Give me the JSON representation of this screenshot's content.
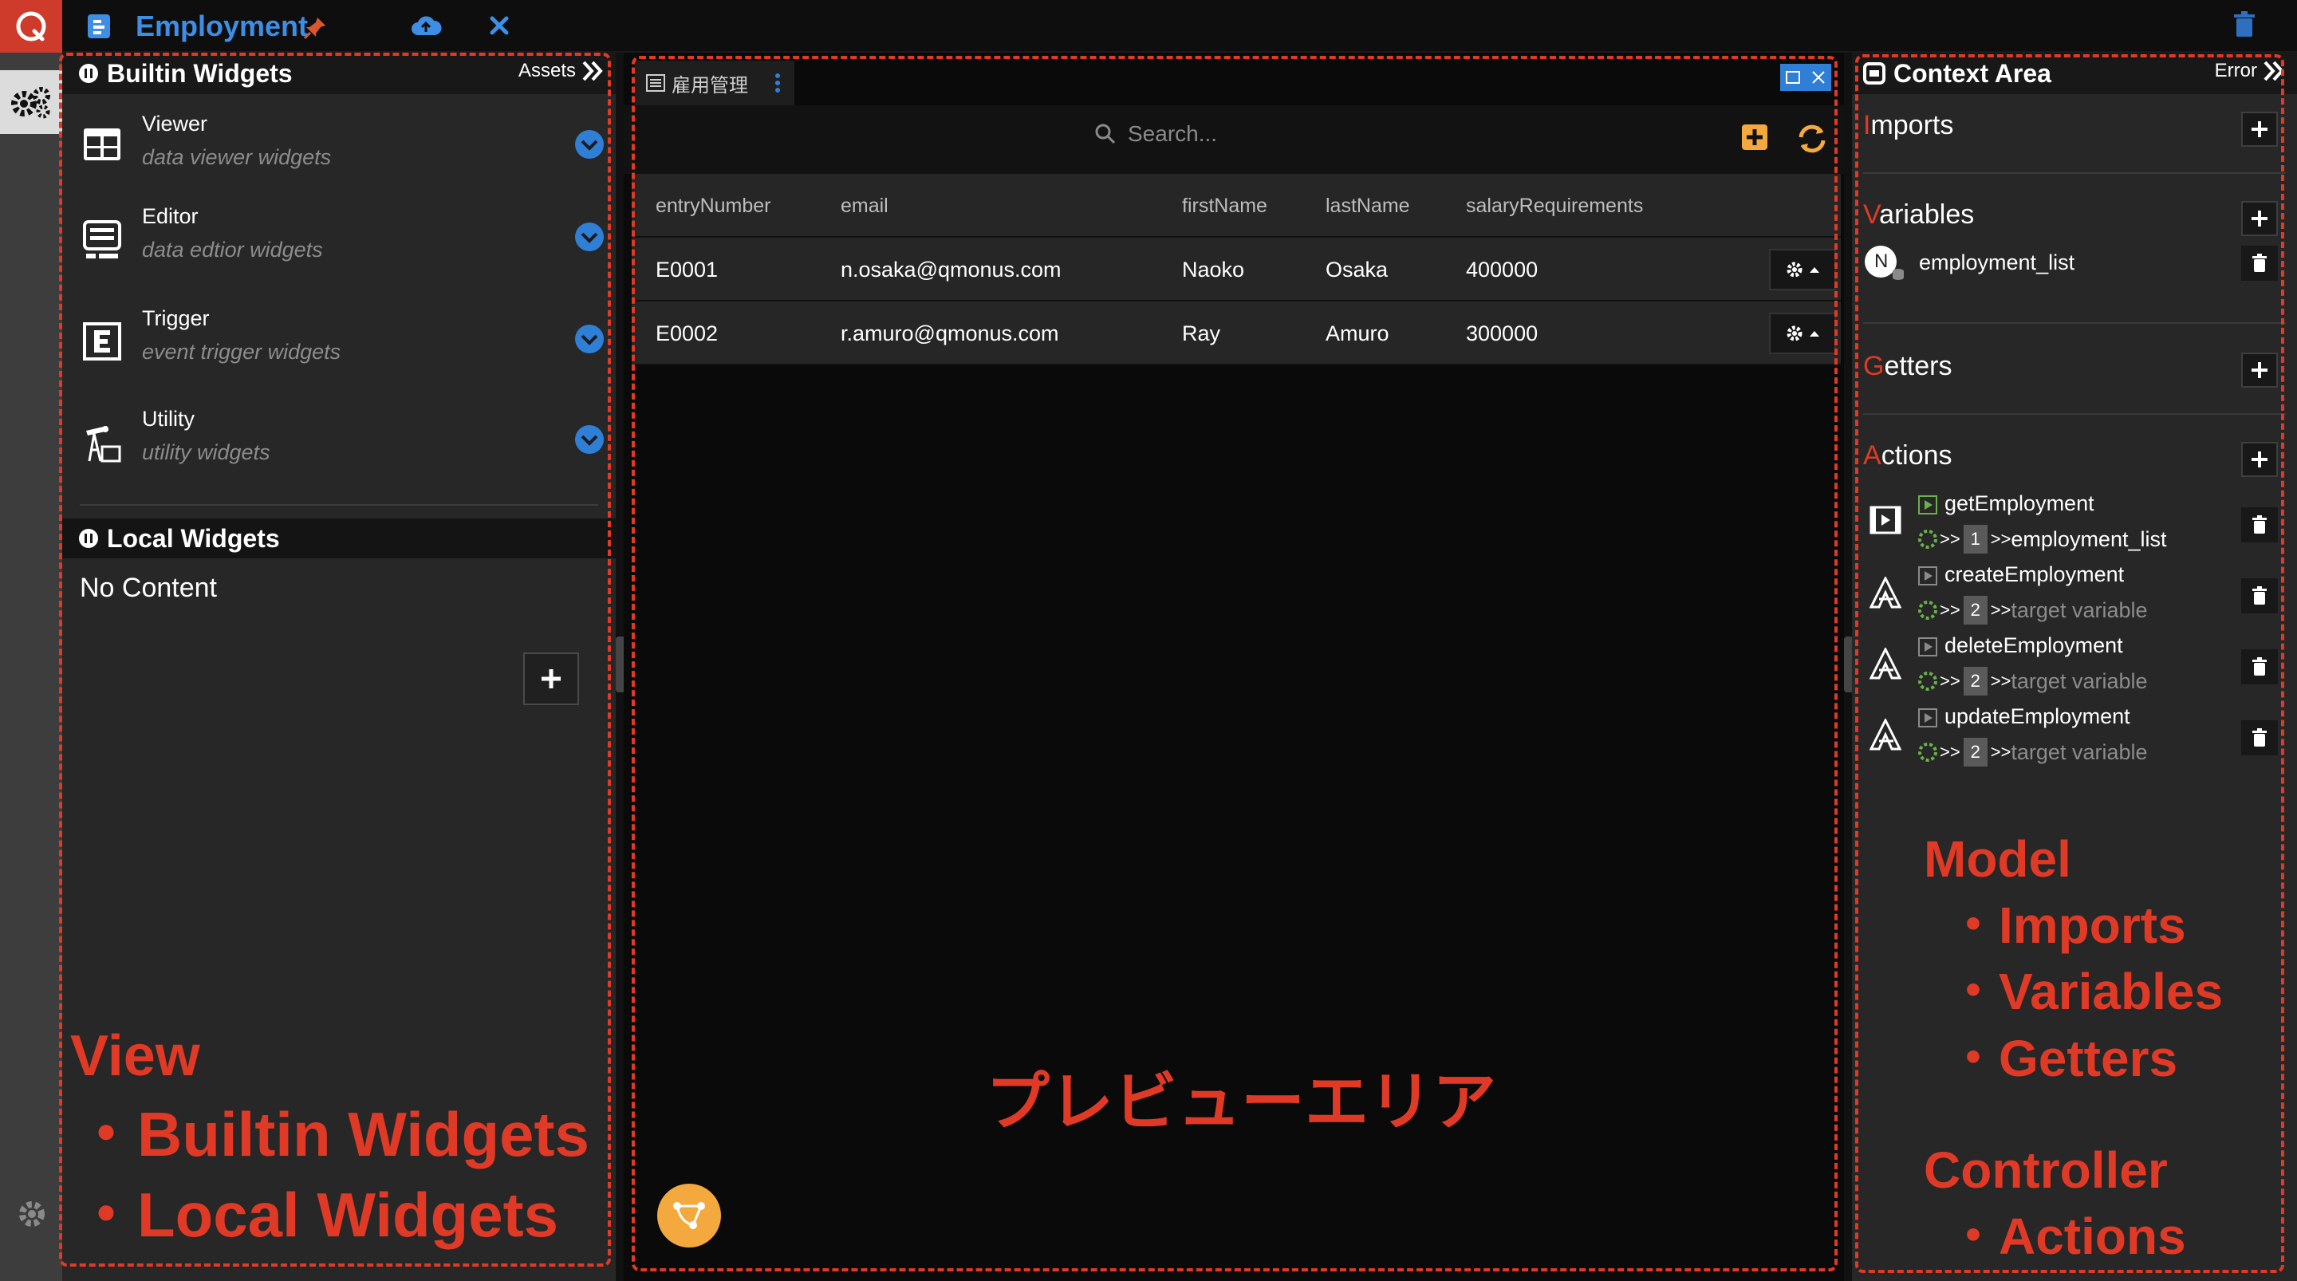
{
  "app": {
    "title": "Employment",
    "icons": [
      "logo-icon",
      "document-icon",
      "pin-icon",
      "cloud-upload-icon",
      "close-icon",
      "trash-icon"
    ]
  },
  "left_panel": {
    "header": {
      "title": "Builtin Widgets",
      "right_label": "Assets"
    },
    "widgets": [
      {
        "title": "Viewer",
        "subtitle": "data viewer widgets",
        "icon": "table-icon"
      },
      {
        "title": "Editor",
        "subtitle": "data edtior widgets",
        "icon": "editor-icon"
      },
      {
        "title": "Trigger",
        "subtitle": "event trigger widgets",
        "icon": "trigger-icon"
      },
      {
        "title": "Utility",
        "subtitle": "utility widgets",
        "icon": "pump-icon"
      }
    ],
    "local": {
      "title": "Local Widgets",
      "empty_text": "No Content"
    }
  },
  "center_panel": {
    "tab_label": "雇用管理",
    "search_placeholder": "Search...",
    "table": {
      "columns": [
        "entryNumber",
        "email",
        "firstName",
        "lastName",
        "salaryRequirements"
      ],
      "rows": [
        [
          "E0001",
          "n.osaka@qmonus.com",
          "Naoko",
          "Osaka",
          "400000"
        ],
        [
          "E0002",
          "r.amuro@qmonus.com",
          "Ray",
          "Amuro",
          "300000"
        ]
      ]
    }
  },
  "right_panel": {
    "header": {
      "title": "Context Area",
      "right_label": "Error"
    },
    "sections": {
      "imports": "Imports",
      "variables": "Variables",
      "getters": "Getters",
      "actions": "Actions"
    },
    "variables": [
      {
        "badge": "N",
        "name": "employment_list"
      }
    ],
    "actions": [
      {
        "name": "getEmployment",
        "step": "1",
        "target": "employment_list",
        "placeholder": false,
        "icon": "film-icon"
      },
      {
        "name": "createEmployment",
        "step": "2",
        "target": "target variable",
        "placeholder": true,
        "icon": "a-logo-icon"
      },
      {
        "name": "deleteEmployment",
        "step": "2",
        "target": "target variable",
        "placeholder": true,
        "icon": "a-logo-icon"
      },
      {
        "name": "updateEmployment",
        "step": "2",
        "target": "target variable",
        "placeholder": true,
        "icon": "a-logo-icon"
      }
    ]
  },
  "annotations": {
    "view": {
      "title": "View",
      "items": [
        "・Builtin Widgets",
        "・Local Widgets"
      ]
    },
    "preview": "プレビューエリア",
    "model": {
      "title": "Model",
      "items": [
        "・Imports",
        "・Variables",
        "・Getters"
      ]
    },
    "controller": {
      "title": "Controller",
      "items": [
        "・Actions"
      ]
    }
  },
  "colors": {
    "accent_red": "#e03a26",
    "brand_blue": "#3d8fe6",
    "check_blue": "#2f7fd7",
    "orange": "#f3a93d",
    "panel_bg": "#272727"
  }
}
